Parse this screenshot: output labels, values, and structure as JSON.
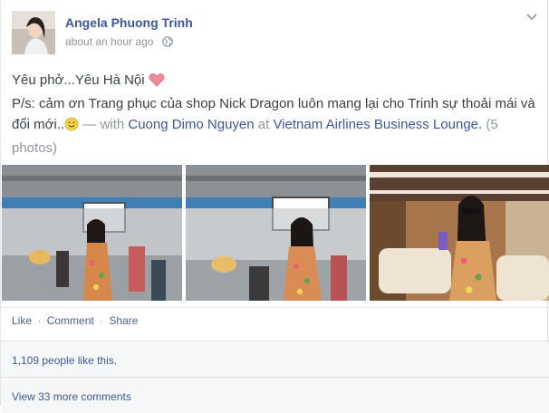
{
  "post": {
    "author": "Angela Phuong Trinh",
    "timestamp": "about an hour ago",
    "privacy_icon": "globe-icon",
    "menu_icon": "chevron-down-icon",
    "text_line1": "Yêu phở...Yêu Hà Nội",
    "text_line2_prefix": "P/s: cảm ơn Trang phục của shop Nick Dragon luôn mang lại cho Trinh sự thoải mái và đổi mới..",
    "with_text": " — with ",
    "tagged_person": "Cuong Dimo Nguyen",
    "at_text": " at ",
    "location": "Vietnam Airlines Business Lounge",
    "period": ".",
    "photo_count": "(5 photos)",
    "heart_icon": "heart-emoji-icon",
    "smile_icon": "smile-emoji-icon"
  },
  "actions": {
    "like": "Like",
    "comment": "Comment",
    "share": "Share",
    "separator": "·"
  },
  "footer": {
    "likes": "1,109 people like this.",
    "more_comments": "View 33 more comments"
  },
  "colors": {
    "link": "#3b5998",
    "muted": "#90949c",
    "footer_bg": "#f6f7f9",
    "heart": "#f0899b"
  }
}
